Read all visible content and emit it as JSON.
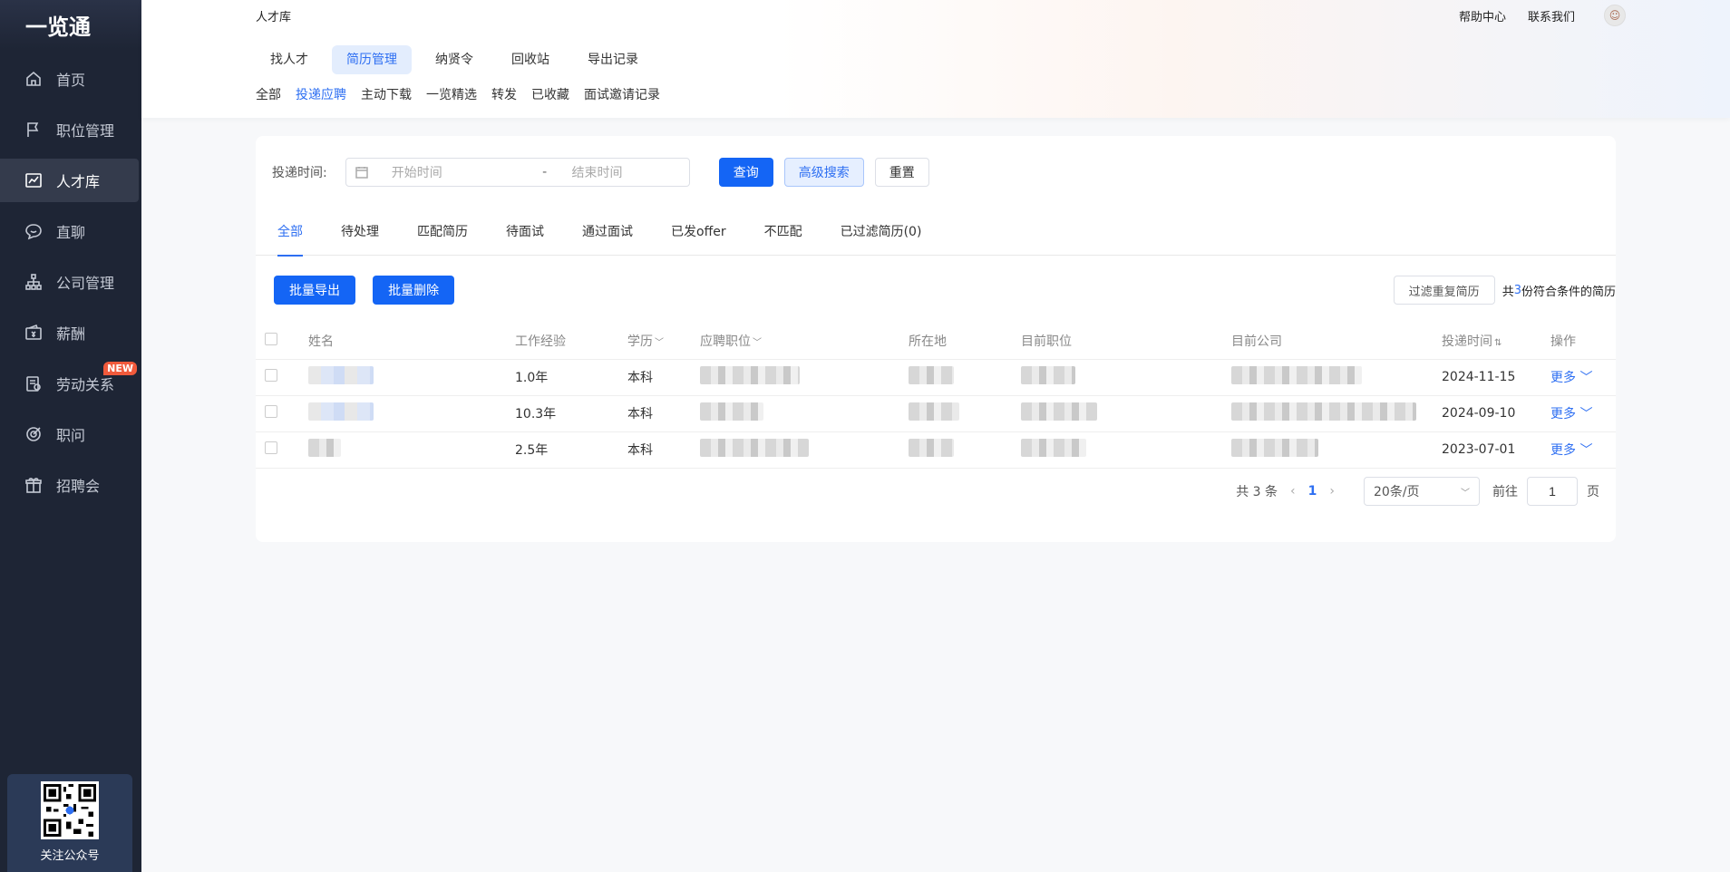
{
  "app": {
    "logo": "一览通"
  },
  "sidebar": {
    "items": [
      {
        "label": "首页",
        "icon": "home-icon"
      },
      {
        "label": "职位管理",
        "icon": "flag-icon"
      },
      {
        "label": "人才库",
        "icon": "chart-icon",
        "active": true
      },
      {
        "label": "直聊",
        "icon": "chat-icon"
      },
      {
        "label": "公司管理",
        "icon": "org-icon"
      },
      {
        "label": "薪酬",
        "icon": "wallet-icon"
      },
      {
        "label": "劳动关系",
        "icon": "contract-icon",
        "badge": "NEW"
      },
      {
        "label": "职问",
        "icon": "target-icon"
      },
      {
        "label": "招聘会",
        "icon": "gift-icon"
      }
    ],
    "qr_label": "关注公众号"
  },
  "header": {
    "title": "人才库",
    "help": "帮助中心",
    "contact": "联系我们",
    "main_tabs": [
      "找人才",
      "简历管理",
      "纳贤令",
      "回收站",
      "导出记录"
    ],
    "sub_tabs": [
      "全部",
      "投递应聘",
      "主动下载",
      "一览精选",
      "转发",
      "已收藏",
      "面试邀请记录"
    ]
  },
  "search": {
    "label": "投递时间:",
    "start_placeholder": "开始时间",
    "separator": "-",
    "end_placeholder": "结束时间",
    "query_btn": "查询",
    "advanced_btn": "高级搜索",
    "reset_btn": "重置"
  },
  "status_tabs": [
    "全部",
    "待处理",
    "匹配简历",
    "待面试",
    "通过面试",
    "已发offer",
    "不匹配",
    "已过滤简历(0)"
  ],
  "actions": {
    "export_btn": "批量导出",
    "delete_btn": "批量删除",
    "filter_btn": "过滤重复简历",
    "count_prefix": "共",
    "count": "3",
    "count_suffix": "份符合条件的简历"
  },
  "table": {
    "headers": [
      "姓名",
      "工作经验",
      "学历",
      "应聘职位",
      "所在地",
      "目前职位",
      "目前公司",
      "投递时间",
      "操作"
    ],
    "rows": [
      {
        "experience": "1.0年",
        "education": "本科",
        "date": "2024-11-15",
        "action": "更多"
      },
      {
        "experience": "10.3年",
        "education": "本科",
        "date": "2024-09-10",
        "action": "更多"
      },
      {
        "experience": "2.5年",
        "education": "本科",
        "date": "2023-07-01",
        "action": "更多"
      }
    ]
  },
  "pagination": {
    "total": "共 3 条",
    "current": "1",
    "page_size": "20条/页",
    "goto_label": "前往",
    "goto_value": "1",
    "page_suffix": "页"
  }
}
